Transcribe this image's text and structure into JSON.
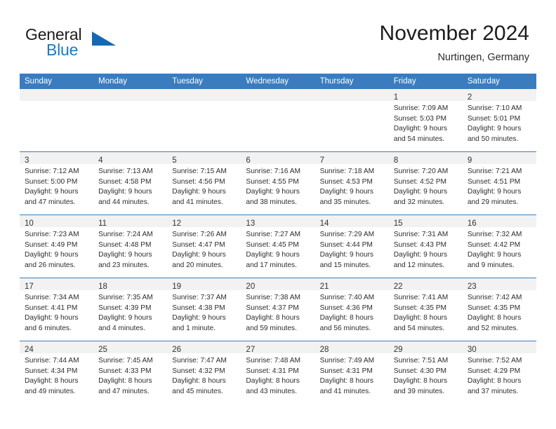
{
  "brand": {
    "name_part1": "General",
    "name_part2": "Blue",
    "accent_color": "#1668b3"
  },
  "header": {
    "title": "November 2024",
    "subtitle": "Nurtingen, Germany"
  },
  "theme": {
    "header_row_bg": "#3a7cbe",
    "daynum_band_bg": "#f2f2f2",
    "grid_line": "#3a7cbe",
    "text": "#2d2d2d"
  },
  "weekday_headers": [
    "Sunday",
    "Monday",
    "Tuesday",
    "Wednesday",
    "Thursday",
    "Friday",
    "Saturday"
  ],
  "weeks": [
    [
      {
        "day": "",
        "lines": []
      },
      {
        "day": "",
        "lines": []
      },
      {
        "day": "",
        "lines": []
      },
      {
        "day": "",
        "lines": []
      },
      {
        "day": "",
        "lines": []
      },
      {
        "day": "1",
        "lines": [
          "Sunrise: 7:09 AM",
          "Sunset: 5:03 PM",
          "Daylight: 9 hours",
          "and 54 minutes."
        ]
      },
      {
        "day": "2",
        "lines": [
          "Sunrise: 7:10 AM",
          "Sunset: 5:01 PM",
          "Daylight: 9 hours",
          "and 50 minutes."
        ]
      }
    ],
    [
      {
        "day": "3",
        "lines": [
          "Sunrise: 7:12 AM",
          "Sunset: 5:00 PM",
          "Daylight: 9 hours",
          "and 47 minutes."
        ]
      },
      {
        "day": "4",
        "lines": [
          "Sunrise: 7:13 AM",
          "Sunset: 4:58 PM",
          "Daylight: 9 hours",
          "and 44 minutes."
        ]
      },
      {
        "day": "5",
        "lines": [
          "Sunrise: 7:15 AM",
          "Sunset: 4:56 PM",
          "Daylight: 9 hours",
          "and 41 minutes."
        ]
      },
      {
        "day": "6",
        "lines": [
          "Sunrise: 7:16 AM",
          "Sunset: 4:55 PM",
          "Daylight: 9 hours",
          "and 38 minutes."
        ]
      },
      {
        "day": "7",
        "lines": [
          "Sunrise: 7:18 AM",
          "Sunset: 4:53 PM",
          "Daylight: 9 hours",
          "and 35 minutes."
        ]
      },
      {
        "day": "8",
        "lines": [
          "Sunrise: 7:20 AM",
          "Sunset: 4:52 PM",
          "Daylight: 9 hours",
          "and 32 minutes."
        ]
      },
      {
        "day": "9",
        "lines": [
          "Sunrise: 7:21 AM",
          "Sunset: 4:51 PM",
          "Daylight: 9 hours",
          "and 29 minutes."
        ]
      }
    ],
    [
      {
        "day": "10",
        "lines": [
          "Sunrise: 7:23 AM",
          "Sunset: 4:49 PM",
          "Daylight: 9 hours",
          "and 26 minutes."
        ]
      },
      {
        "day": "11",
        "lines": [
          "Sunrise: 7:24 AM",
          "Sunset: 4:48 PM",
          "Daylight: 9 hours",
          "and 23 minutes."
        ]
      },
      {
        "day": "12",
        "lines": [
          "Sunrise: 7:26 AM",
          "Sunset: 4:47 PM",
          "Daylight: 9 hours",
          "and 20 minutes."
        ]
      },
      {
        "day": "13",
        "lines": [
          "Sunrise: 7:27 AM",
          "Sunset: 4:45 PM",
          "Daylight: 9 hours",
          "and 17 minutes."
        ]
      },
      {
        "day": "14",
        "lines": [
          "Sunrise: 7:29 AM",
          "Sunset: 4:44 PM",
          "Daylight: 9 hours",
          "and 15 minutes."
        ]
      },
      {
        "day": "15",
        "lines": [
          "Sunrise: 7:31 AM",
          "Sunset: 4:43 PM",
          "Daylight: 9 hours",
          "and 12 minutes."
        ]
      },
      {
        "day": "16",
        "lines": [
          "Sunrise: 7:32 AM",
          "Sunset: 4:42 PM",
          "Daylight: 9 hours",
          "and 9 minutes."
        ]
      }
    ],
    [
      {
        "day": "17",
        "lines": [
          "Sunrise: 7:34 AM",
          "Sunset: 4:41 PM",
          "Daylight: 9 hours",
          "and 6 minutes."
        ]
      },
      {
        "day": "18",
        "lines": [
          "Sunrise: 7:35 AM",
          "Sunset: 4:39 PM",
          "Daylight: 9 hours",
          "and 4 minutes."
        ]
      },
      {
        "day": "19",
        "lines": [
          "Sunrise: 7:37 AM",
          "Sunset: 4:38 PM",
          "Daylight: 9 hours",
          "and 1 minute."
        ]
      },
      {
        "day": "20",
        "lines": [
          "Sunrise: 7:38 AM",
          "Sunset: 4:37 PM",
          "Daylight: 8 hours",
          "and 59 minutes."
        ]
      },
      {
        "day": "21",
        "lines": [
          "Sunrise: 7:40 AM",
          "Sunset: 4:36 PM",
          "Daylight: 8 hours",
          "and 56 minutes."
        ]
      },
      {
        "day": "22",
        "lines": [
          "Sunrise: 7:41 AM",
          "Sunset: 4:35 PM",
          "Daylight: 8 hours",
          "and 54 minutes."
        ]
      },
      {
        "day": "23",
        "lines": [
          "Sunrise: 7:42 AM",
          "Sunset: 4:35 PM",
          "Daylight: 8 hours",
          "and 52 minutes."
        ]
      }
    ],
    [
      {
        "day": "24",
        "lines": [
          "Sunrise: 7:44 AM",
          "Sunset: 4:34 PM",
          "Daylight: 8 hours",
          "and 49 minutes."
        ]
      },
      {
        "day": "25",
        "lines": [
          "Sunrise: 7:45 AM",
          "Sunset: 4:33 PM",
          "Daylight: 8 hours",
          "and 47 minutes."
        ]
      },
      {
        "day": "26",
        "lines": [
          "Sunrise: 7:47 AM",
          "Sunset: 4:32 PM",
          "Daylight: 8 hours",
          "and 45 minutes."
        ]
      },
      {
        "day": "27",
        "lines": [
          "Sunrise: 7:48 AM",
          "Sunset: 4:31 PM",
          "Daylight: 8 hours",
          "and 43 minutes."
        ]
      },
      {
        "day": "28",
        "lines": [
          "Sunrise: 7:49 AM",
          "Sunset: 4:31 PM",
          "Daylight: 8 hours",
          "and 41 minutes."
        ]
      },
      {
        "day": "29",
        "lines": [
          "Sunrise: 7:51 AM",
          "Sunset: 4:30 PM",
          "Daylight: 8 hours",
          "and 39 minutes."
        ]
      },
      {
        "day": "30",
        "lines": [
          "Sunrise: 7:52 AM",
          "Sunset: 4:29 PM",
          "Daylight: 8 hours",
          "and 37 minutes."
        ]
      }
    ]
  ]
}
